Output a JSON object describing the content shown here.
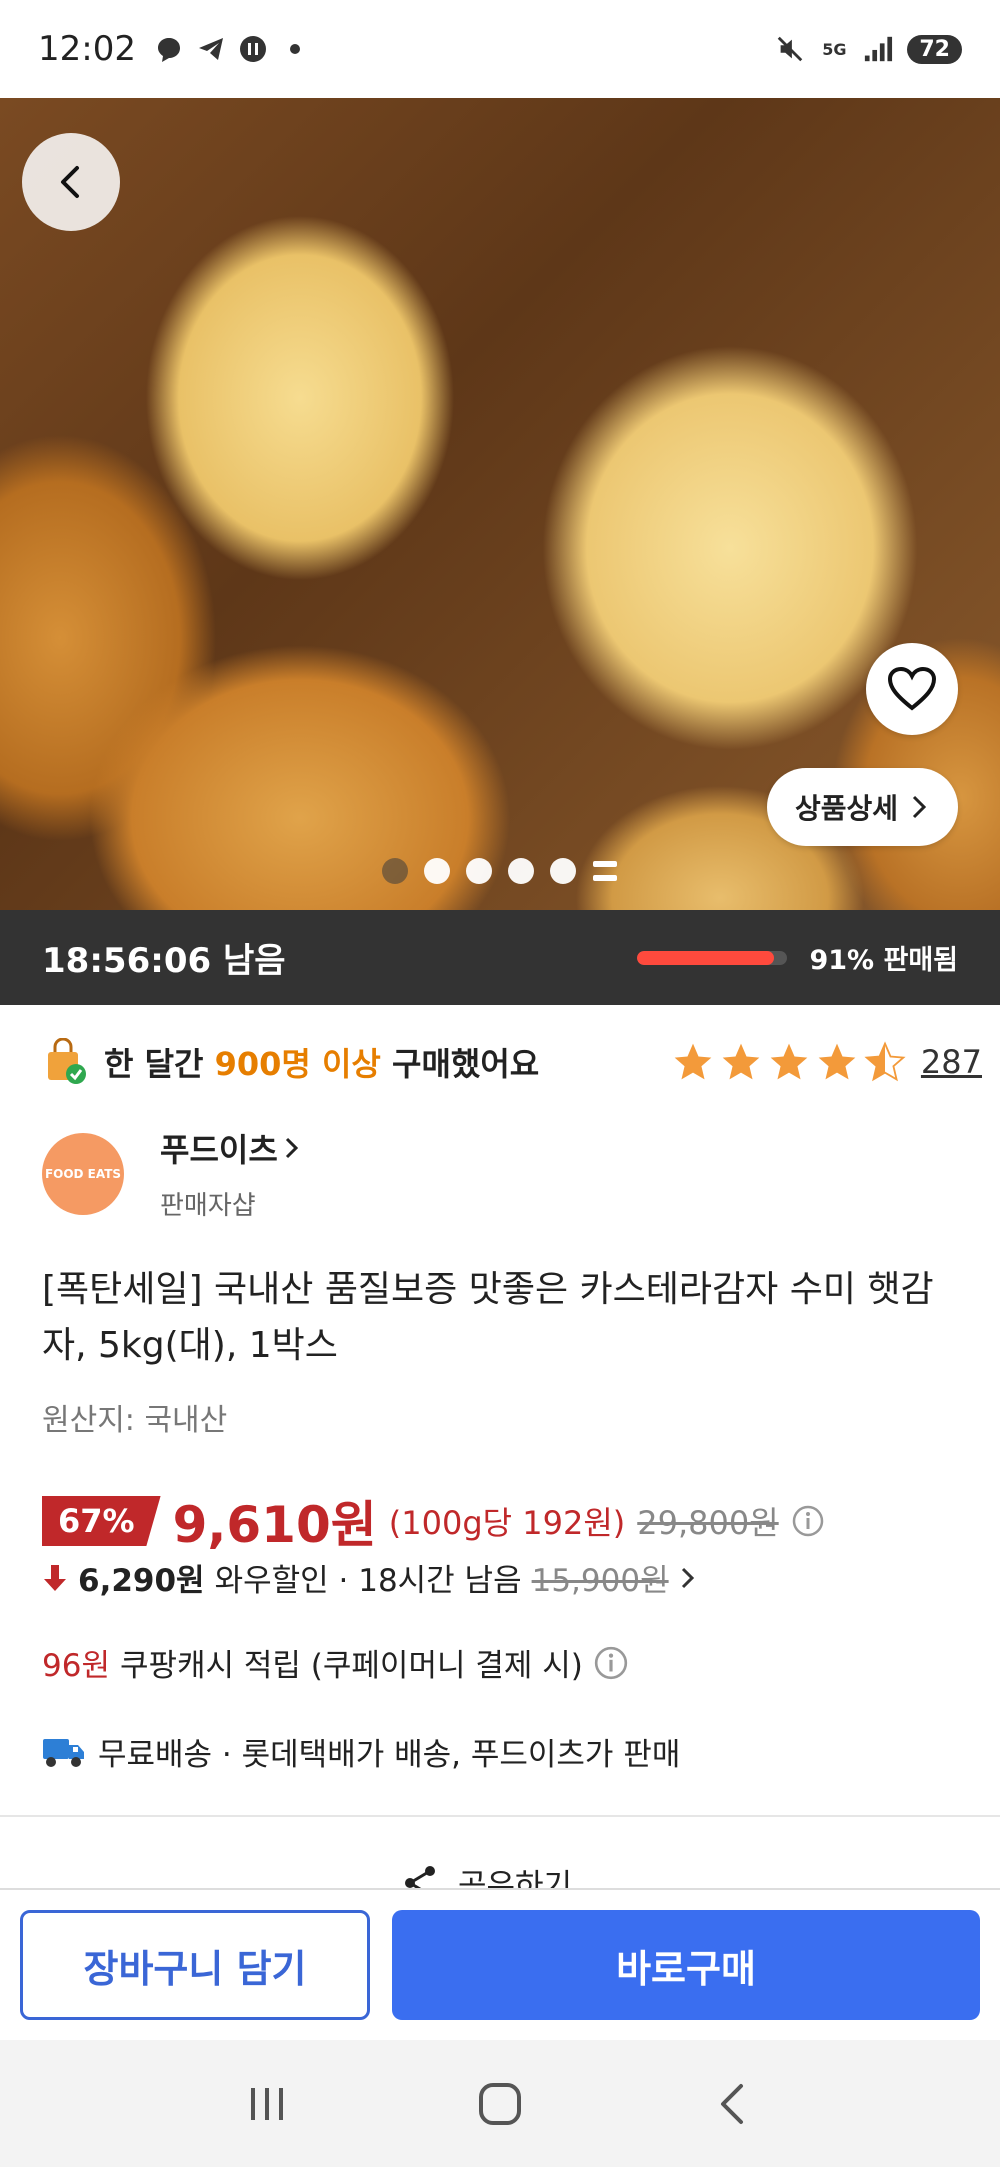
{
  "status_bar": {
    "time": "12:02",
    "network": "5G",
    "battery": "72"
  },
  "hero": {
    "detail_label": "상품상세",
    "page_count": 5,
    "active_index": 0
  },
  "timer": {
    "remaining": "18:56:06 남음",
    "sold_percent": 91,
    "sold_label": "91% 판매됨"
  },
  "purchase_info": {
    "prefix": "한 달간 ",
    "highlight": "900명 이상",
    "suffix": " 구매했어요",
    "rating": 4.5,
    "review_count": "287"
  },
  "seller": {
    "logo_text": "FOOD EATS",
    "name": "푸드이츠",
    "type": "판매자샵"
  },
  "product": {
    "title": "[폭탄세일] 국내산 품질보증 맛좋은 카스테라감자 수미 햇감자, 5kg(대), 1박스",
    "origin": "원산지: 국내산"
  },
  "price": {
    "discount": "67%",
    "sale_price": "9,610원",
    "unit_price": "(100g당 192원)",
    "original_price": "29,800원"
  },
  "wow": {
    "price": "6,290원",
    "label": "와우할인 · 18시간 남음",
    "strike_price": "15,900원"
  },
  "cash": {
    "amount": "96원",
    "label": "쿠팡캐시 적립 (쿠페이머니 결제 시)"
  },
  "shipping": {
    "label": "무료배송 · 롯데택배가 배송, 푸드이츠가 판매"
  },
  "share": {
    "label": "공유하기"
  },
  "cta": {
    "cart_label": "장바구니 담기",
    "buy_label": "바로구매"
  },
  "colors": {
    "accent_blue": "#3a6ef0",
    "price_red": "#c0282a",
    "progress_red": "#ff4a3d",
    "highlight_orange": "#e67e00",
    "star_orange": "#f39a3a"
  }
}
